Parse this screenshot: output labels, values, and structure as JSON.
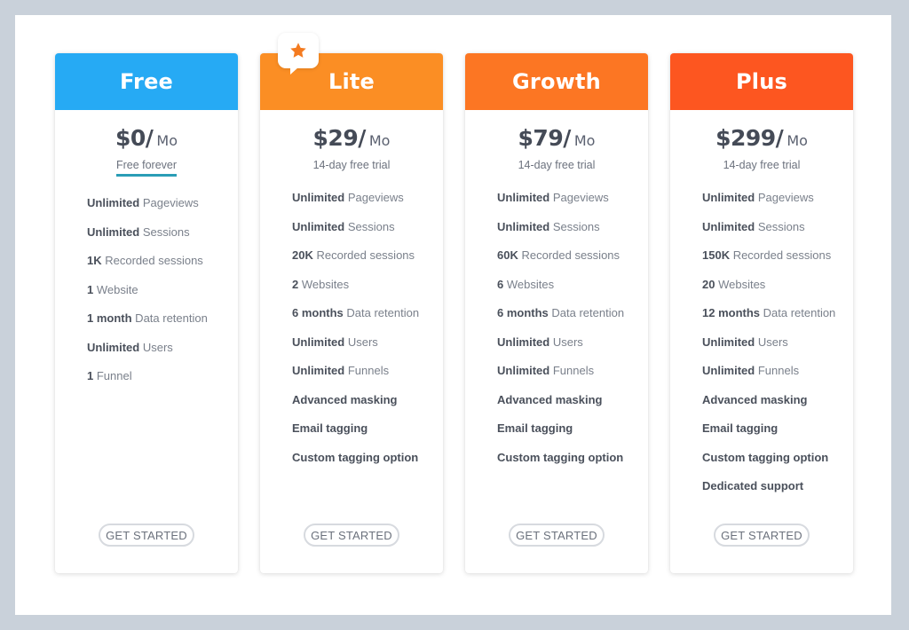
{
  "colors": {
    "free": "#26aaf4",
    "lite": "#fb8e24",
    "growth": "#fc7623",
    "plus": "#fd5620",
    "star": "#f47b20"
  },
  "plans": [
    {
      "name": "Free",
      "price": "$0/",
      "period": "Mo",
      "subtitle": "Free forever",
      "features": [
        {
          "bold": "Unlimited",
          "text": " Pageviews"
        },
        {
          "bold": "Unlimited",
          "text": " Sessions"
        },
        {
          "bold": "1K",
          "text": " Recorded sessions"
        },
        {
          "bold": "1",
          "text": " Website"
        },
        {
          "bold": "1 month",
          "text": " Data retention"
        },
        {
          "bold": "Unlimited",
          "text": " Users"
        },
        {
          "bold": "1",
          "text": " Funnel"
        }
      ],
      "button": "GET STARTED"
    },
    {
      "name": "Lite",
      "badge_icon": "star-icon",
      "price": "$29/",
      "period": "Mo",
      "subtitle": "14-day free trial",
      "features": [
        {
          "bold": "Unlimited",
          "text": " Pageviews"
        },
        {
          "bold": "Unlimited",
          "text": " Sessions"
        },
        {
          "bold": "20K",
          "text": " Recorded sessions"
        },
        {
          "bold": "2",
          "text": " Websites"
        },
        {
          "bold": "6 months",
          "text": " Data retention"
        },
        {
          "bold": "Unlimited",
          "text": " Users"
        },
        {
          "bold": "Unlimited",
          "text": " Funnels"
        },
        {
          "bold": "Advanced masking",
          "text": ""
        },
        {
          "bold": "Email tagging",
          "text": ""
        },
        {
          "bold": "Custom tagging option",
          "text": ""
        }
      ],
      "button": "GET STARTED"
    },
    {
      "name": "Growth",
      "price": "$79/",
      "period": "Mo",
      "subtitle": "14-day free trial",
      "features": [
        {
          "bold": "Unlimited",
          "text": " Pageviews"
        },
        {
          "bold": "Unlimited",
          "text": " Sessions"
        },
        {
          "bold": "60K",
          "text": " Recorded sessions"
        },
        {
          "bold": "6",
          "text": " Websites"
        },
        {
          "bold": "6 months",
          "text": " Data retention"
        },
        {
          "bold": "Unlimited",
          "text": " Users"
        },
        {
          "bold": "Unlimited",
          "text": " Funnels"
        },
        {
          "bold": "Advanced masking",
          "text": ""
        },
        {
          "bold": "Email tagging",
          "text": ""
        },
        {
          "bold": "Custom tagging option",
          "text": ""
        }
      ],
      "button": "GET STARTED"
    },
    {
      "name": "Plus",
      "price": "$299/",
      "period": "Mo",
      "subtitle": "14-day free trial",
      "features": [
        {
          "bold": "Unlimited",
          "text": " Pageviews"
        },
        {
          "bold": "Unlimited",
          "text": " Sessions"
        },
        {
          "bold": "150K",
          "text": " Recorded sessions"
        },
        {
          "bold": "20",
          "text": " Websites"
        },
        {
          "bold": "12 months",
          "text": " Data retention"
        },
        {
          "bold": "Unlimited",
          "text": " Users"
        },
        {
          "bold": "Unlimited",
          "text": " Funnels"
        },
        {
          "bold": "Advanced masking",
          "text": ""
        },
        {
          "bold": "Email tagging",
          "text": ""
        },
        {
          "bold": "Custom tagging option",
          "text": ""
        },
        {
          "bold": "Dedicated support",
          "text": ""
        }
      ],
      "button": "GET STARTED"
    }
  ]
}
